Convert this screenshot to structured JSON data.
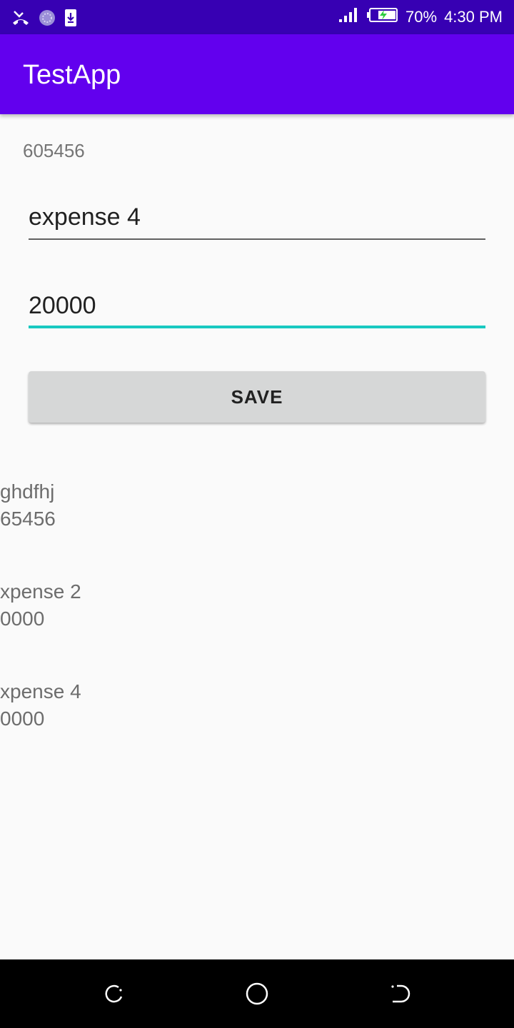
{
  "status_bar": {
    "battery_percent": "70%",
    "time": "4:30 PM",
    "icons": [
      "missed-call-icon",
      "app-notification-icon",
      "download-icon",
      "signal-icon",
      "battery-charging-icon"
    ]
  },
  "app_bar": {
    "title": "TestApp"
  },
  "form": {
    "id_label": "605456",
    "name_value": "expense 4",
    "amount_value": "20000",
    "save_label": "SAVE"
  },
  "list": [
    {
      "name": "ghdfhj",
      "amount": "65456"
    },
    {
      "name": "xpense 2",
      "amount": "0000"
    },
    {
      "name": "xpense 4",
      "amount": "0000"
    }
  ],
  "nav_bar": {
    "icons": [
      "back-icon",
      "home-icon",
      "recents-icon"
    ]
  },
  "colors": {
    "status_bar": "#3700b3",
    "app_bar": "#6200ee",
    "accent": "#18c9c1"
  }
}
